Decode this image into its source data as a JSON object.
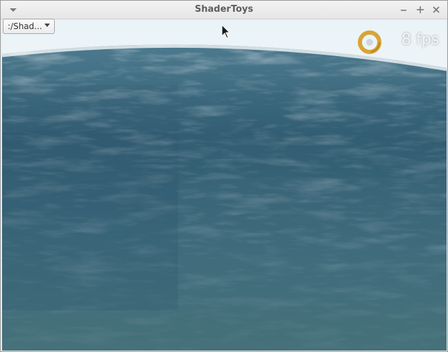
{
  "window": {
    "title": "ShaderToys"
  },
  "toolbar": {
    "source_selector": {
      "value": ":/Shad..."
    }
  },
  "overlay": {
    "fps_text": "8 fps"
  },
  "icons": {
    "window_menu": "chevron-down-icon",
    "minimize": "minimize-icon",
    "maximize": "plus-icon",
    "close": "close-icon",
    "loading": "spinner-icon",
    "cursor": "cursor-icon"
  },
  "colors": {
    "sky": "#f4f9fb",
    "ocean_deep": "#355f74",
    "ocean_mid": "#3f6b7c",
    "ocean_near": "#46717a",
    "spinner": "#d9a437"
  }
}
